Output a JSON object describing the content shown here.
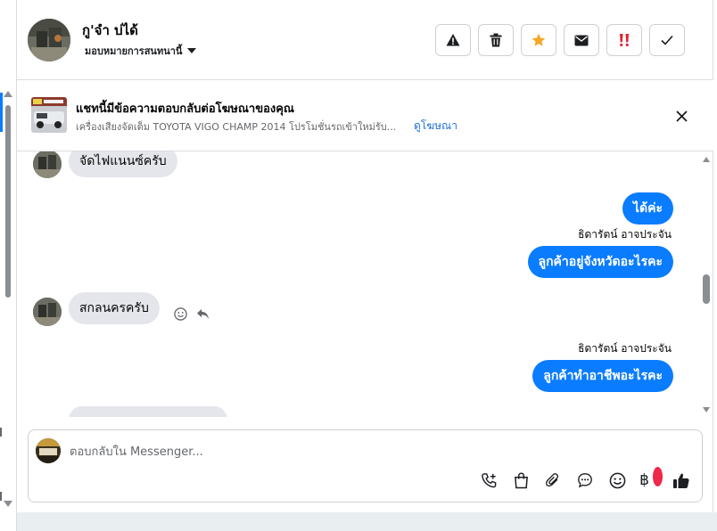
{
  "header": {
    "contact_name": "กู'จำ บ่ได้",
    "assign_label": "มอบหมายการสนทนานี้",
    "actions": [
      "warning-icon",
      "trash-icon",
      "star-icon",
      "envelope-icon",
      "double-exclamation-icon",
      "check-icon"
    ]
  },
  "ad_banner": {
    "title": "แชทนี้มีข้อความตอบกลับต่อโฆษณาของคุณ",
    "description": "เครื่องเสียงจัดเต็ม TOYOTA VIGO CHAMP 2014 โปรโมชั่นรถเข้าใหม่รับ...",
    "link": "ดูโฆษณา"
  },
  "messages": [
    {
      "direction": "in",
      "text": "จัดไฟแนนซ์ครับ"
    },
    {
      "direction": "out",
      "text": "ได้ค่ะ"
    },
    {
      "direction": "out",
      "sender": "ธิดารัตน์ อาจประจัน",
      "text": "ลูกค้าอยู่จังหวัดอะไรคะ"
    },
    {
      "direction": "in",
      "text": "สกลนครครับ"
    },
    {
      "direction": "out",
      "sender": "ธิดารัตน์ อาจประจัน",
      "text": "ลูกค้าทำอาชีพอะไรคะ"
    }
  ],
  "composer": {
    "placeholder": "ตอบกลับใน Messenger...",
    "tools": [
      "phone-plus-icon",
      "shopping-bag-icon",
      "paperclip-icon",
      "chat-bubble-icon",
      "emoji-icon",
      "baht-icon",
      "thumbs-up-icon"
    ],
    "baht_symbol": "฿"
  },
  "colors": {
    "accent": "#0a7cff",
    "incoming_bubble": "#e4e6eb",
    "star": "#f5a623",
    "alert_red": "#e4222e",
    "link": "#216fdb"
  }
}
